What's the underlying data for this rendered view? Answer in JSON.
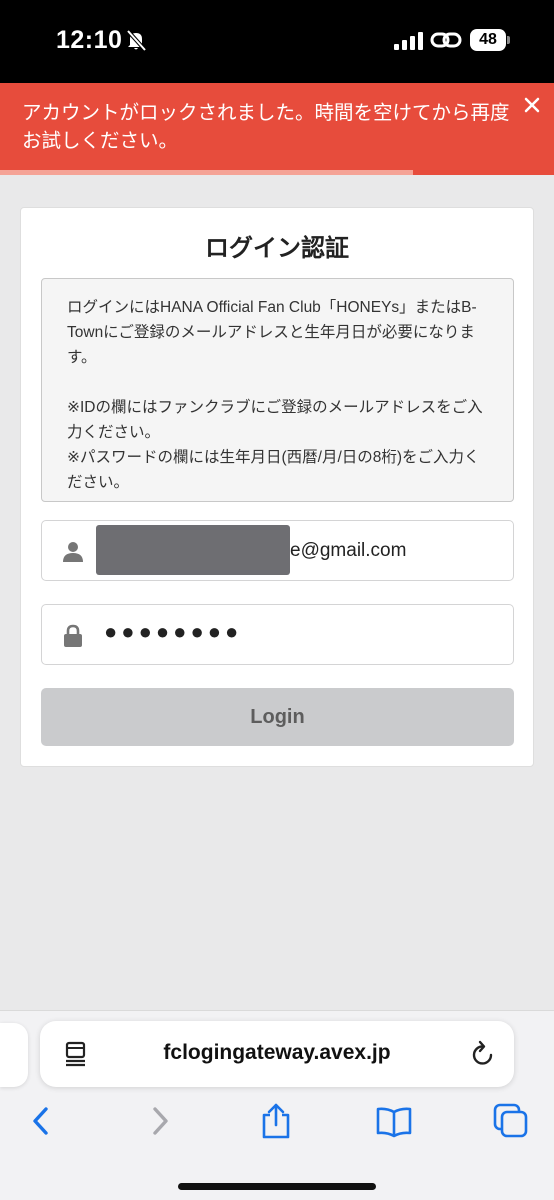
{
  "status_bar": {
    "time": "12:10",
    "battery": "48"
  },
  "alert": {
    "message": "アカウントがロックされました。時間を空けてから再度お試しください。",
    "close_label": "×",
    "color": "#e74c3c"
  },
  "card": {
    "title": "ログイン認証",
    "info": {
      "line1": "ログインにはHANA Official Fan Club「HONEYs」またはB-Townにご登録のメールアドレスと生年月日が必要になります。",
      "line2": "※IDの欄にはファンクラブにご登録のメールアドレスをご入力ください。",
      "line3": "※パスワードの欄には生年月日(西暦/月/日の8桁)をご入力ください。"
    },
    "email_value": "e@gmail.com",
    "password_value": "●●●●●●●●",
    "login_label": "Login"
  },
  "browser": {
    "url": "fclogingateway.avex.jp"
  },
  "icons": {
    "user": "user-icon",
    "lock": "lock-icon",
    "reader": "reader-icon",
    "reload": "reload-icon",
    "back": "back-icon",
    "forward": "forward-icon",
    "share": "share-icon",
    "bookmarks": "bookmarks-icon",
    "tabs": "tabs-icon"
  },
  "colors": {
    "accent": "#1a73e8",
    "button": "#cacbcd"
  }
}
